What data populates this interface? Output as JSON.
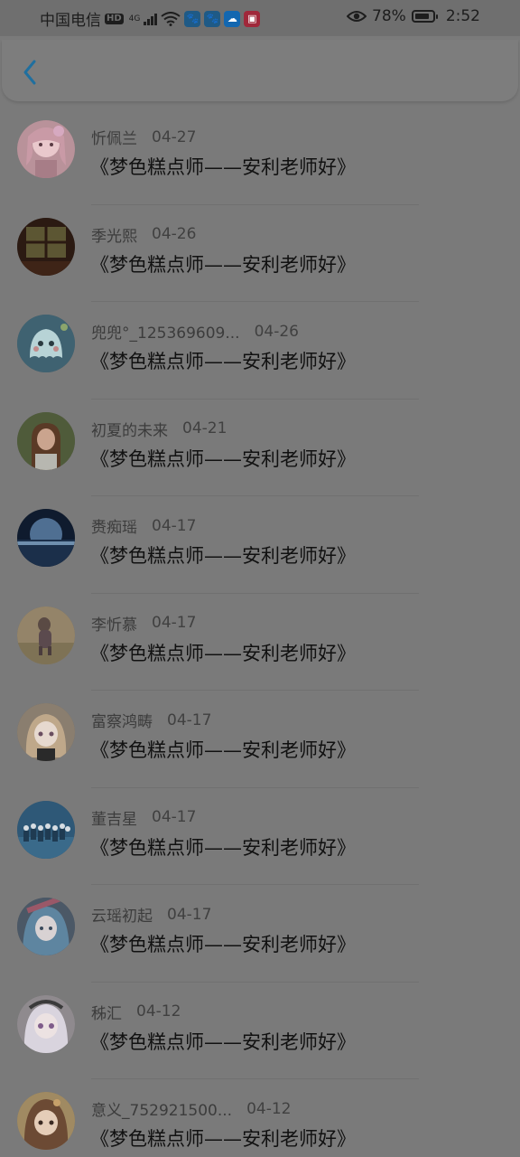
{
  "status_bar": {
    "carrier": "中国电信",
    "hd_badge": "HD",
    "network_type": "4G",
    "battery_percent": "78%",
    "time": "2:52",
    "icons": [
      "eye-icon",
      "battery-icon",
      "baidu-app-icon",
      "baidu-app-icon-2",
      "cloud-app-icon",
      "reader-app-icon"
    ]
  },
  "header": {
    "back_icon": "chevron-left-icon",
    "accent_color": "#1f6f9f"
  },
  "list": [
    {
      "nickname": "忻佩兰",
      "date": "04-27",
      "title": "《梦色糕点师——安利老师好》",
      "avatar": "pink-girl"
    },
    {
      "nickname": "季光熙",
      "date": "04-26",
      "title": "《梦色糕点师——安利老师好》",
      "avatar": "window-room"
    },
    {
      "nickname": "兜兜°_125369609...",
      "date": "04-26",
      "title": "《梦色糕点师——安利老师好》",
      "avatar": "ghost-cartoon"
    },
    {
      "nickname": "初夏的未来",
      "date": "04-21",
      "title": "《梦色糕点师——安利老师好》",
      "avatar": "girl-outdoor"
    },
    {
      "nickname": "赉痴瑶",
      "date": "04-17",
      "title": "《梦色糕点师——安利老师好》",
      "avatar": "night-moon"
    },
    {
      "nickname": "李忻慕",
      "date": "04-17",
      "title": "《梦色糕点师——安利老师好》",
      "avatar": "child-field"
    },
    {
      "nickname": "富察鸿畴",
      "date": "04-17",
      "title": "《梦色糕点师——安利老师好》",
      "avatar": "anime-blonde"
    },
    {
      "nickname": "董吉星",
      "date": "04-17",
      "title": "《梦色糕点师——安利老师好》",
      "avatar": "group-photo"
    },
    {
      "nickname": "云瑶初起",
      "date": "04-17",
      "title": "《梦色糕点师——安利老师好》",
      "avatar": "anime-blue"
    },
    {
      "nickname": "秭汇",
      "date": "04-12",
      "title": "《梦色糕点师——安利老师好》",
      "avatar": "anime-white-hair"
    },
    {
      "nickname": "意义_752921500...",
      "date": "04-12",
      "title": "《梦色糕点师——安利老师好》",
      "avatar": "anime-brown-hair"
    }
  ]
}
